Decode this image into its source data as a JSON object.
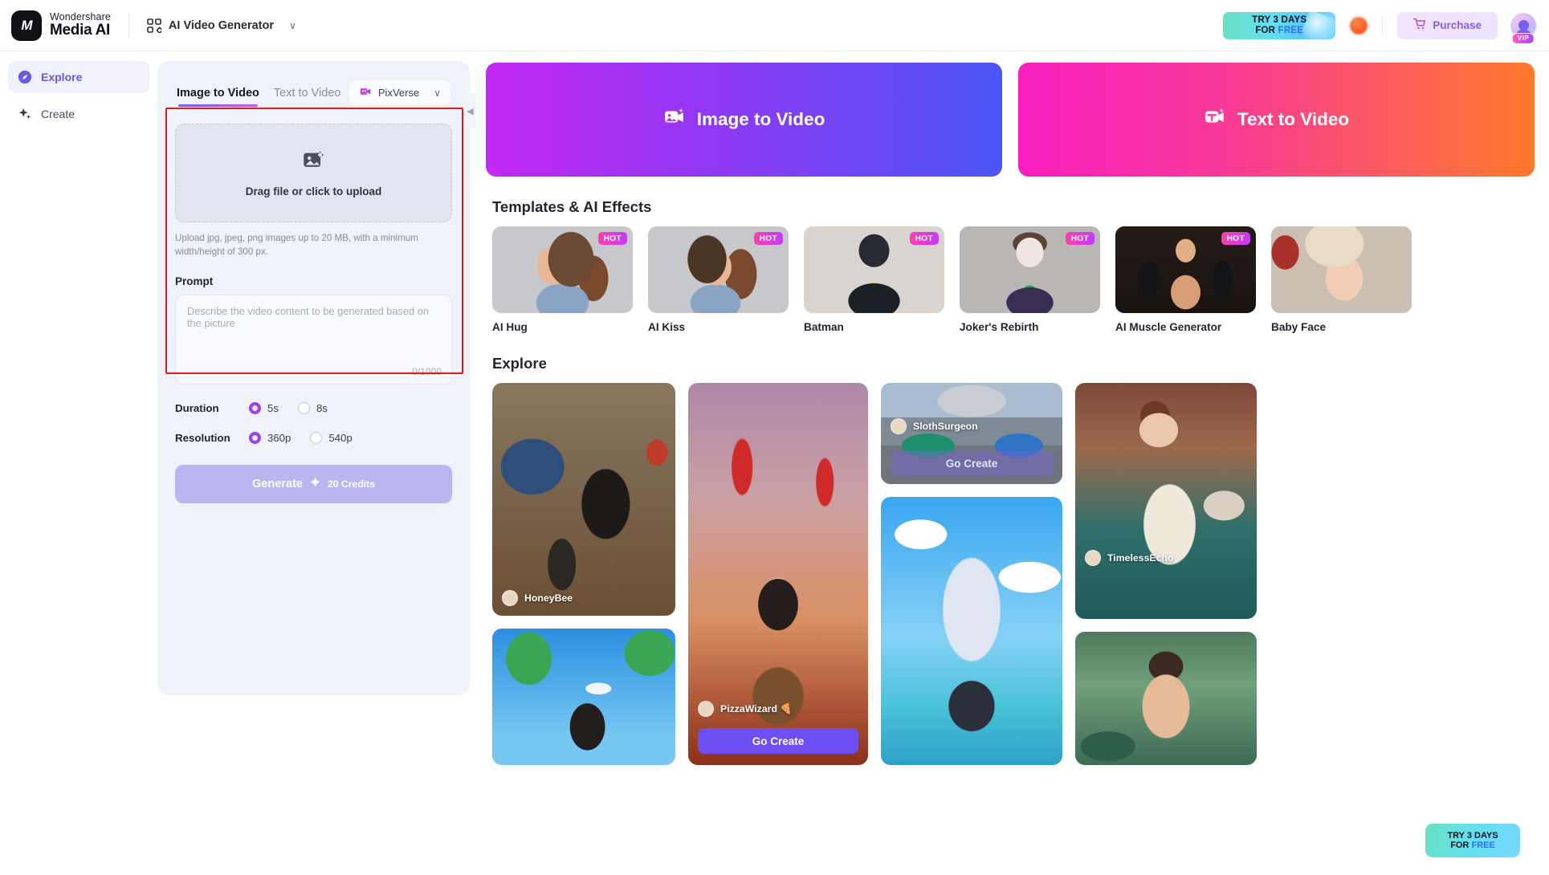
{
  "header": {
    "brand_line1": "Wondershare",
    "brand_line2": "Media AI",
    "brand_mark": "M",
    "module_label": "AI Video Generator",
    "module_caret": "∨",
    "promo_line1": "TRY 3 DAYS",
    "promo_line2_pre": "FOR ",
    "promo_line2_em": "FREE",
    "purchase_label": "Purchase",
    "cart_icon": "cart-icon",
    "vip_badge": "VIP"
  },
  "sidebar": {
    "items": [
      {
        "label": "Explore",
        "icon": "compass-icon",
        "active": true
      },
      {
        "label": "Create",
        "icon": "sparkle-icon",
        "active": false
      }
    ]
  },
  "panel": {
    "tabs": [
      {
        "label": "Image to Video",
        "active": true
      },
      {
        "label": "Text to Video",
        "active": false
      }
    ],
    "model": {
      "label": "PixVerse",
      "icon": "pixverse-icon",
      "caret": "∨"
    },
    "dropzone": {
      "label": "Drag file or click to upload",
      "icon": "image-add-icon"
    },
    "upload_hint": "Upload jpg, jpeg, png images up to 20 MB, with a minimum width/height of 300 px.",
    "prompt": {
      "label": "Prompt",
      "placeholder": "Describe the video content to be generated based on the picture",
      "value": "",
      "counter": "0/1000"
    },
    "duration": {
      "label": "Duration",
      "options": [
        {
          "label": "5s",
          "selected": true
        },
        {
          "label": "8s",
          "selected": false
        }
      ]
    },
    "resolution": {
      "label": "Resolution",
      "options": [
        {
          "label": "360p",
          "selected": true
        },
        {
          "label": "540p",
          "selected": false
        }
      ]
    },
    "generate": {
      "label": "Generate",
      "credits": "20 Credits",
      "spark_icon": "sparkle-icon"
    },
    "collapse_icon": "chevron-left-icon"
  },
  "main": {
    "banners": [
      {
        "label": "Image to Video",
        "icon": "image-video-icon",
        "style": "i2v"
      },
      {
        "label": "Text to Video",
        "icon": "text-video-icon",
        "style": "t2v"
      }
    ],
    "templates_title": "Templates & AI Effects",
    "templates": [
      {
        "name": "AI Hug",
        "badge": "HOT"
      },
      {
        "name": "AI Kiss",
        "badge": "HOT"
      },
      {
        "name": "Batman",
        "badge": "HOT"
      },
      {
        "name": "Joker's Rebirth",
        "badge": "HOT"
      },
      {
        "name": "AI Muscle Generator",
        "badge": "HOT"
      },
      {
        "name": "Baby Face",
        "badge": ""
      }
    ],
    "explore_title": "Explore",
    "explore": [
      {
        "user": "HoneyBee",
        "cta": ""
      },
      {
        "user": "",
        "cta": ""
      },
      {
        "user": "PizzaWizard 🍕",
        "cta": "Go Create"
      },
      {
        "user": "SlothSurgeon",
        "cta": "Go Create"
      },
      {
        "user": "",
        "cta": ""
      },
      {
        "user": "TimelessEcho",
        "cta": ""
      },
      {
        "user": "",
        "cta": ""
      }
    ],
    "float_promo": {
      "line1": "TRY 3 DAYS",
      "line2_pre": "FOR ",
      "line2_em": "FREE"
    }
  },
  "colors": {
    "accent": "#6a59e8",
    "brand_purple": "#7b5cf5",
    "hot_badge": "#ff3ea8",
    "highlight_box": "#e01b1b"
  }
}
